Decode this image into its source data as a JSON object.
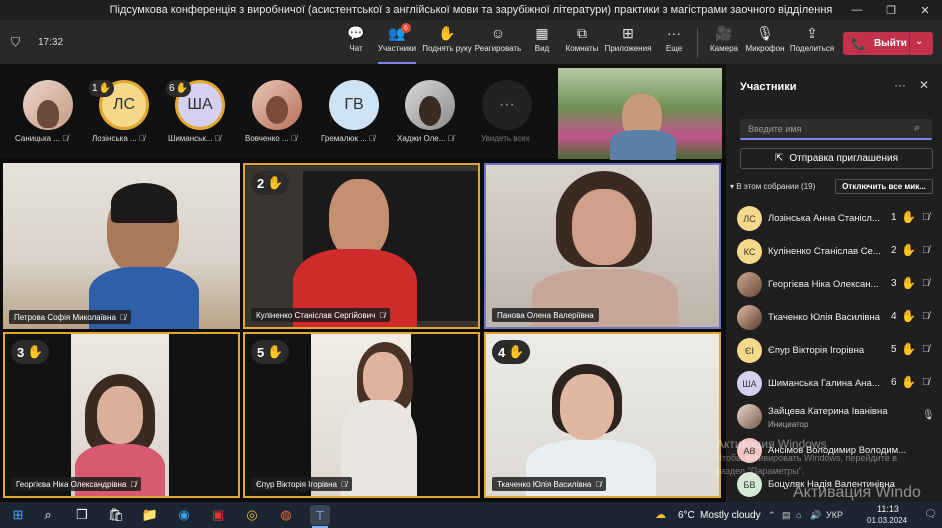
{
  "window": {
    "title": "Підсумкова конференція з виробничої (асистентської з англійської мови та зарубіжної літератури) практики з магістрами заочного відділення"
  },
  "meeting": {
    "timer": "17:32"
  },
  "toolbar": {
    "chat": "Чат",
    "participants": "Участники",
    "participants_badge": "6",
    "raise_hand": "Поднять руку",
    "react": "Реагировать",
    "view": "Вид",
    "rooms": "Комнаты",
    "apps": "Приложения",
    "more": "Еще",
    "camera": "Камера",
    "mic": "Микрофон",
    "share": "Поделиться",
    "leave": "Выйти"
  },
  "strip": {
    "people": [
      {
        "initials": "",
        "name": "Саницька ...",
        "hand": ""
      },
      {
        "initials": "ЛС",
        "name": "Лозінська ...",
        "hand": "1"
      },
      {
        "initials": "ША",
        "name": "Шиманськ...",
        "hand": "6"
      },
      {
        "initials": "",
        "name": "Вовченко ...",
        "hand": ""
      },
      {
        "initials": "ГВ",
        "name": "Гремалюк ...",
        "hand": ""
      },
      {
        "initials": "",
        "name": "Хаджи Оле...",
        "hand": ""
      }
    ],
    "see_all": "Увидеть всех"
  },
  "tiles": [
    {
      "name": "Петрова Софія Миколаївна",
      "hand": ""
    },
    {
      "name": "Куліненко Станіслав Сергійович",
      "hand": "2"
    },
    {
      "name": "Панова Олена Валеріївна",
      "hand": ""
    },
    {
      "name": "Георгієва Ніка Олександрівна",
      "hand": "3"
    },
    {
      "name": "Єпур Вікторія Ігорівна",
      "hand": "5"
    },
    {
      "name": "Ткаченко Юлія Василівна",
      "hand": "4"
    }
  ],
  "panel": {
    "title": "Участники",
    "search_placeholder": "Введите имя",
    "invite": "Отправка приглашения",
    "section": "В этом собрании (19)",
    "mute_all": "Отключить все мик...",
    "rows": [
      {
        "initials": "ЛС",
        "name": "Лозінська Анна Станісл...",
        "num": "1",
        "hand": true,
        "role": ""
      },
      {
        "initials": "КС",
        "name": "Куліненко Станіслав Се...",
        "num": "2",
        "hand": true,
        "role": ""
      },
      {
        "initials": "",
        "name": "Георгієва Ніка Олексан...",
        "num": "3",
        "hand": true,
        "role": ""
      },
      {
        "initials": "",
        "name": "Ткаченко Юлія Василівна",
        "num": "4",
        "hand": true,
        "role": ""
      },
      {
        "initials": "ЄІ",
        "name": "Єпур Вікторія Ігорівна",
        "num": "5",
        "hand": true,
        "role": ""
      },
      {
        "initials": "ША",
        "name": "Шиманська Галина Ана...",
        "num": "6",
        "hand": true,
        "role": ""
      },
      {
        "initials": "",
        "name": "Зайцева Катерина Іванівна",
        "num": "",
        "hand": false,
        "role": "Инициатор"
      },
      {
        "initials": "АВ",
        "name": "Ансімов Володимир Володим...",
        "num": "",
        "hand": false,
        "role": ""
      },
      {
        "initials": "БВ",
        "name": "Боцуляк Надія Валентинівна",
        "num": "",
        "hand": false,
        "role": ""
      }
    ]
  },
  "watermark": {
    "line1": "Активация Windows",
    "line2": "Чтобы активировать Windows, перейдите в",
    "line3": "раздел \"Параметры\".",
    "big": "Активация Windo"
  },
  "taskbar": {
    "weather": "6°C",
    "weather_text": "Mostly cloudy",
    "lang": "УКР",
    "time": "11:13",
    "date": "01.03.2024"
  }
}
